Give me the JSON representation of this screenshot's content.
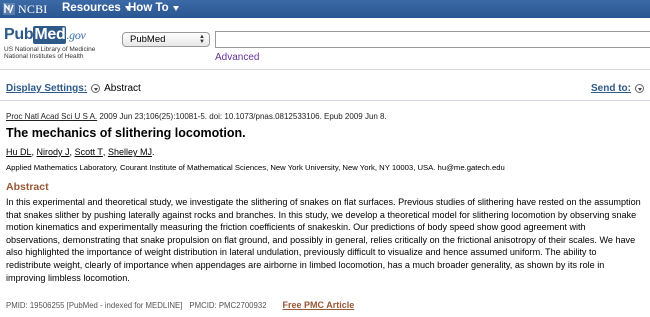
{
  "topbar": {
    "brand": "NCBI",
    "menus": [
      {
        "label": "Resources"
      },
      {
        "label": "How To"
      }
    ]
  },
  "header": {
    "logo": {
      "pub": "Pub",
      "med": "Med",
      "gov": ".gov"
    },
    "library_line1": "US National Library of Medicine",
    "library_line2": "National Institutes of Health",
    "database": "PubMed",
    "search_value": "",
    "advanced": "Advanced"
  },
  "settings": {
    "label": "Display Settings:",
    "value": "Abstract",
    "send_to": "Send to:"
  },
  "article": {
    "journal": "Proc Natl Acad Sci U S A.",
    "citation_rest": " 2009 Jun 23;106(25):10081-5. doi: 10.1073/pnas.0812533106. Epub 2009 Jun 8.",
    "title": "The mechanics of slithering locomotion.",
    "authors": [
      "Hu DL",
      "Nirody J",
      "Scott T",
      "Shelley MJ"
    ],
    "affiliation": "Applied Mathematics Laboratory, Courant Institute of Mathematical Sciences, New York University, New York, NY 10003, USA. hu@me.gatech.edu",
    "abstract_heading": "Abstract",
    "abstract_text": "In this experimental and theoretical study, we investigate the slithering of snakes on flat surfaces. Previous studies of slithering have rested on the assumption that snakes slither by pushing laterally against rocks and branches. In this study, we develop a theoretical model for slithering locomotion by observing snake motion kinematics and experimentally measuring the friction coefficients of snakeskin. Our predictions of body speed show good agreement with observations, demonstrating that snake propulsion on flat ground, and possibly in general, relies critically on the frictional anisotropy of their scales. We have also highlighted the importance of weight distribution in lateral undulation, previously difficult to visualize and hence assumed uniform. The ability to redistribute weight, clearly of importance when appendages are airborne in limbed locomotion, has a much broader generality, as shown by its role in improving limbless locomotion.",
    "pmid": "PMID: 19506255 [PubMed - indexed for MEDLINE]",
    "pmcid": "PMCID: PMC2700932",
    "free_pmc": "Free PMC Article"
  },
  "colors": {
    "topbar": "#2a5590",
    "link": "#2e5a88",
    "abstract_heading": "#985735",
    "visited": "#663399"
  }
}
